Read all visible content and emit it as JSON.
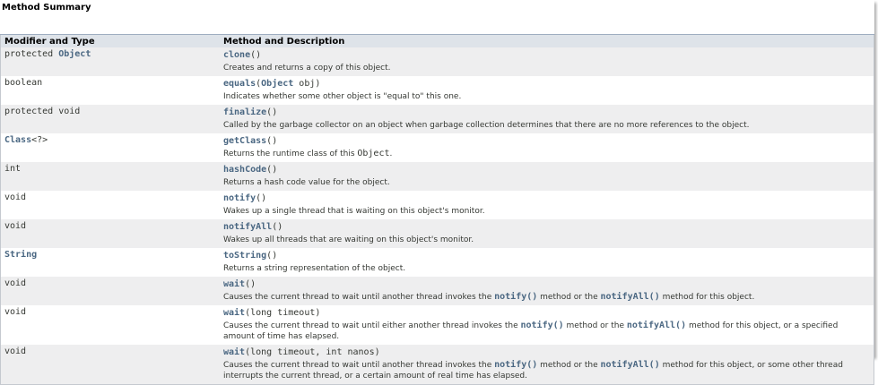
{
  "title": "Method Summary",
  "headers": {
    "modifier": "Modifier and Type",
    "method": "Method and Description"
  },
  "rows": [
    {
      "mod_plain": "protected ",
      "mod_link": "Object",
      "mod_suffix": "",
      "name": "clone",
      "params_pre": "()",
      "params_link": "",
      "params_post": "",
      "desc": "Creates and returns a copy of this object."
    },
    {
      "mod_plain": "boolean",
      "mod_link": "",
      "mod_suffix": "",
      "name": "equals",
      "params_pre": "(",
      "params_link": "Object",
      "params_post": " obj)",
      "desc": "Indicates whether some other object is \"equal to\" this one."
    },
    {
      "mod_plain": "protected void",
      "mod_link": "",
      "mod_suffix": "",
      "name": "finalize",
      "params_pre": "()",
      "params_link": "",
      "params_post": "",
      "desc": "Called by the garbage collector on an object when garbage collection determines that there are no more references to the object."
    },
    {
      "mod_plain": "",
      "mod_link": "Class",
      "mod_suffix": "<?>",
      "name": "getClass",
      "params_pre": "()",
      "params_link": "",
      "params_post": "",
      "desc_pre": "Returns the runtime class of this ",
      "desc_code": "Object",
      "desc_post": "."
    },
    {
      "mod_plain": "int",
      "mod_link": "",
      "mod_suffix": "",
      "name": "hashCode",
      "params_pre": "()",
      "params_link": "",
      "params_post": "",
      "desc": "Returns a hash code value for the object."
    },
    {
      "mod_plain": "void",
      "mod_link": "",
      "mod_suffix": "",
      "name": "notify",
      "params_pre": "()",
      "params_link": "",
      "params_post": "",
      "desc": "Wakes up a single thread that is waiting on this object's monitor."
    },
    {
      "mod_plain": "void",
      "mod_link": "",
      "mod_suffix": "",
      "name": "notifyAll",
      "params_pre": "()",
      "params_link": "",
      "params_post": "",
      "desc": "Wakes up all threads that are waiting on this object's monitor."
    },
    {
      "mod_plain": "",
      "mod_link": "String",
      "mod_suffix": "",
      "name": "toString",
      "params_pre": "()",
      "params_link": "",
      "params_post": "",
      "desc": "Returns a string representation of the object."
    },
    {
      "mod_plain": "void",
      "mod_link": "",
      "mod_suffix": "",
      "name": "wait",
      "params_pre": "()",
      "params_link": "",
      "params_post": "",
      "desc_a": "Causes the current thread to wait until another thread invokes the ",
      "desc_l1": "notify()",
      "desc_b": " method or the ",
      "desc_l2": "notifyAll()",
      "desc_c": " method for this object."
    },
    {
      "mod_plain": "void",
      "mod_link": "",
      "mod_suffix": "",
      "name": "wait",
      "params_pre": "(long timeout)",
      "params_link": "",
      "params_post": "",
      "desc_a": "Causes the current thread to wait until either another thread invokes the ",
      "desc_l1": "notify()",
      "desc_b": " method or the ",
      "desc_l2": "notifyAll()",
      "desc_c": " method for this object, or a specified amount of time has elapsed."
    },
    {
      "mod_plain": "void",
      "mod_link": "",
      "mod_suffix": "",
      "name": "wait",
      "params_pre": "(long timeout, int nanos)",
      "params_link": "",
      "params_post": "",
      "desc_a": "Causes the current thread to wait until another thread invokes the ",
      "desc_l1": "notify()",
      "desc_b": " method or the ",
      "desc_l2": "notifyAll()",
      "desc_c": " method for this object, or some other thread interrupts the current thread, or a certain amount of real time has elapsed."
    }
  ]
}
